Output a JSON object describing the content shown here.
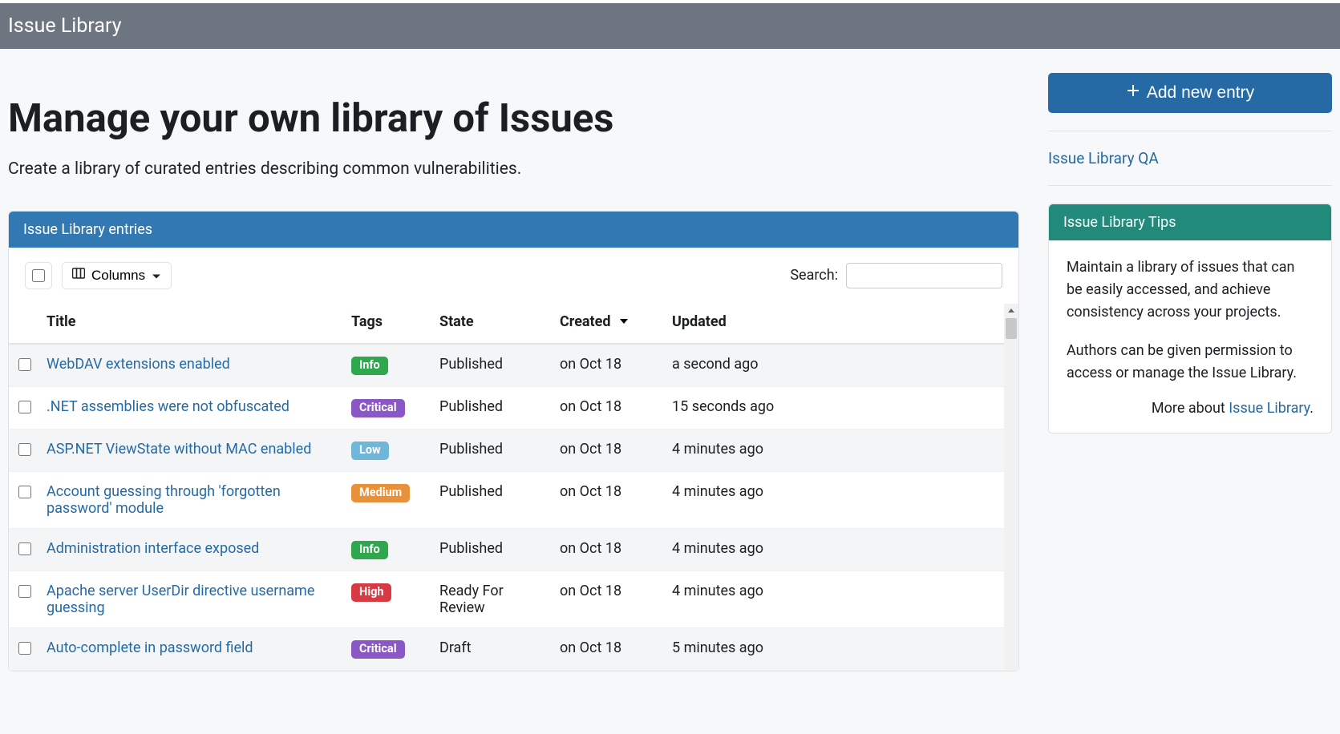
{
  "header": {
    "title": "Issue Library"
  },
  "page": {
    "title": "Manage your own library of Issues",
    "lead": "Create a library of curated entries describing common vulnerabilities."
  },
  "panel": {
    "title": "Issue Library entries",
    "columns_label": "Columns",
    "search_label": "Search:",
    "search_value": ""
  },
  "table": {
    "headers": {
      "title": "Title",
      "tags": "Tags",
      "state": "State",
      "created": "Created",
      "updated": "Updated"
    },
    "rows": [
      {
        "title": "WebDAV extensions enabled",
        "tag": "Info",
        "state": "Published",
        "created": "on Oct 18",
        "updated": "a second ago"
      },
      {
        "title": ".NET assemblies were not obfuscated",
        "tag": "Critical",
        "state": "Published",
        "created": "on Oct 18",
        "updated": "15 seconds ago"
      },
      {
        "title": "ASP.NET ViewState without MAC enabled",
        "tag": "Low",
        "state": "Published",
        "created": "on Oct 18",
        "updated": "4 minutes ago"
      },
      {
        "title": "Account guessing through 'forgotten password' module",
        "tag": "Medium",
        "state": "Published",
        "created": "on Oct 18",
        "updated": "4 minutes ago"
      },
      {
        "title": "Administration interface exposed",
        "tag": "Info",
        "state": "Published",
        "created": "on Oct 18",
        "updated": "4 minutes ago"
      },
      {
        "title": "Apache server UserDir directive username guessing",
        "tag": "High",
        "state": "Ready For Review",
        "created": "on Oct 18",
        "updated": "4 minutes ago"
      },
      {
        "title": "Auto-complete in password field",
        "tag": "Critical",
        "state": "Draft",
        "created": "on Oct 18",
        "updated": "5 minutes ago"
      }
    ]
  },
  "sidebar": {
    "add_button": "Add new entry",
    "qa_link": "Issue Library QA",
    "tips_title": "Issue Library Tips",
    "tips_p1": "Maintain a library of issues that can be easily accessed, and achieve consistency across your projects.",
    "tips_p2": "Authors can be given permission to access or manage the Issue Library.",
    "more_prefix": "More about ",
    "more_link": "Issue Library"
  }
}
